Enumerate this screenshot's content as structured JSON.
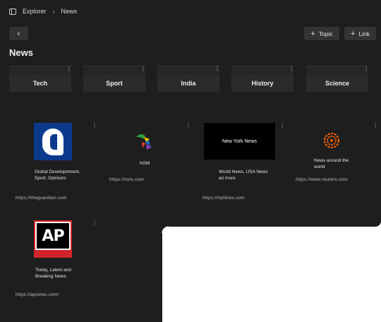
{
  "breadcrumb": {
    "root": "Explorer",
    "separator": "›",
    "current": "News"
  },
  "toolbar": {
    "back_glyph": "‹",
    "plus_glyph": "+",
    "topic_label": "Topic",
    "link_label": "Link"
  },
  "page": {
    "title": "News"
  },
  "menu_glyph": "⋮",
  "topics": [
    {
      "label": "Tech"
    },
    {
      "label": "Sport"
    },
    {
      "label": "India"
    },
    {
      "label": "History"
    },
    {
      "label": "Science"
    }
  ],
  "links": [
    {
      "icon": "guardian-logo",
      "description": "Global Developmnent, Sport, Opinions",
      "url": "https://theguardian.com"
    },
    {
      "icon": "nsm-logo",
      "logo_text": "NSM",
      "description": "",
      "url": "https://nsm.com"
    },
    {
      "icon": "nytimes-logo",
      "logo_text": "New York News",
      "description": "World News, USA News an more",
      "url": "https://nytimes.com"
    },
    {
      "icon": "reuters-logo",
      "description": "News around the world",
      "url": "https://www.reuters.com"
    },
    {
      "icon": "ap-logo",
      "logo_text": "AP",
      "description": "Today, Latest and Breaking News",
      "url": "https://apnews.com/"
    }
  ],
  "colors": {
    "window_bg": "#1e1e1e",
    "card_bg": "#2b2b2b",
    "button_bg": "#333333",
    "guardian_blue": "#0b3a8c",
    "ap_red": "#d2232a",
    "reuters_orange": "#fa6400"
  }
}
